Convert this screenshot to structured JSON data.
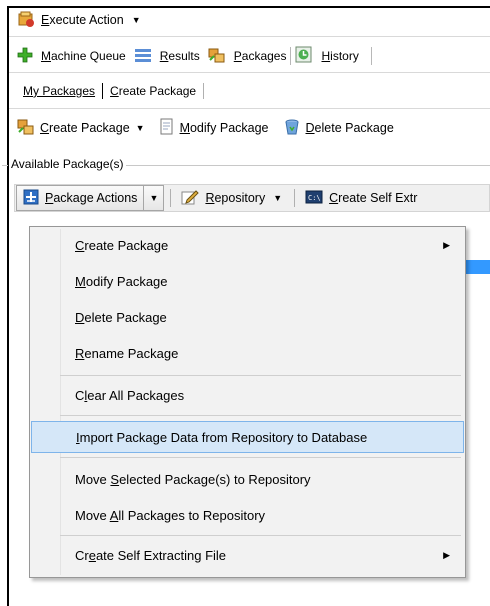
{
  "execute_bar": {
    "label": "Execute Action",
    "mnemonic": "E",
    "rest": "xecute Action"
  },
  "main_nav": [
    {
      "pre": "",
      "u": "M",
      "post": "achine Queue",
      "icon": "plus-icon"
    },
    {
      "pre": "",
      "u": "R",
      "post": "esults",
      "icon": "results-icon"
    },
    {
      "pre": "",
      "u": "P",
      "post": "ackages",
      "icon": "packages-icon"
    },
    {
      "pre": "",
      "u": "H",
      "post": "istory",
      "icon": "history-icon"
    }
  ],
  "sub_tabs": {
    "my_packages": {
      "u": "M",
      "post": "y Packages"
    },
    "create_package": {
      "u": "C",
      "post": "reate Package"
    }
  },
  "package_bar": {
    "create": {
      "u": "C",
      "post": "reate Package"
    },
    "modify": {
      "u": "M",
      "post": "odify Package"
    },
    "delete": {
      "u": "D",
      "post": "elete Package"
    }
  },
  "group_label": "Available Package(s)",
  "action_bar": {
    "package_actions": {
      "u": "P",
      "post": "ackage Actions"
    },
    "repository": {
      "u": "R",
      "post": "epository"
    },
    "create_self_extr": {
      "u": "C",
      "post": "reate Self Extr"
    }
  },
  "context_menu": {
    "items": [
      {
        "pre": "",
        "u": "C",
        "post": "reate Package"
      },
      {
        "pre": "",
        "u": "M",
        "post": "odify Package"
      },
      {
        "pre": "",
        "u": "D",
        "post": "elete Package"
      },
      {
        "pre": "",
        "u": "R",
        "post": "ename Package"
      },
      {
        "pre": "C",
        "u": "l",
        "post": "ear All Packages"
      },
      {
        "pre": "",
        "u": "I",
        "post": "mport Package Data from Repository to Database"
      },
      {
        "pre": "Move ",
        "u": "S",
        "post": "elected Package(s) to Repository"
      },
      {
        "pre": "Move ",
        "u": "A",
        "post": "ll Packages to Repository"
      },
      {
        "pre": "Cr",
        "u": "e",
        "post": "ate Self Extracting File"
      }
    ]
  },
  "colors": {
    "selection": "#3399ff",
    "menu_bg": "#f2f2f2",
    "menu_highlight": "#d5e7f8"
  }
}
